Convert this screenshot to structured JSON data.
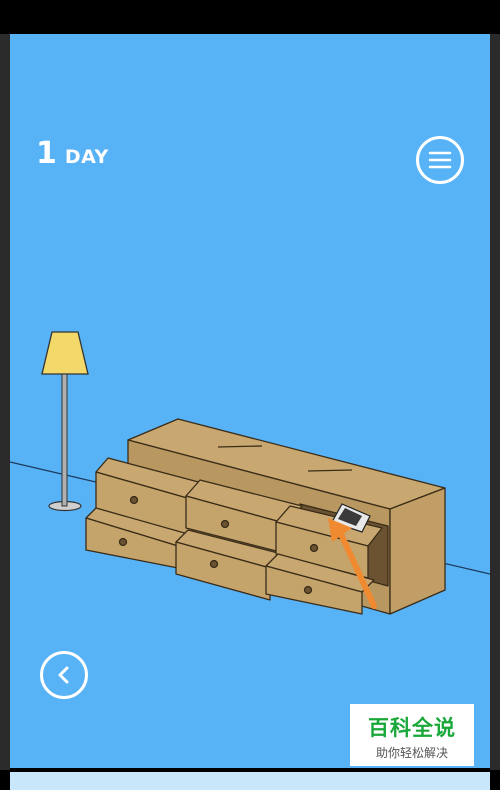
{
  "hud": {
    "day_number": "1",
    "day_label": "DAY"
  },
  "icons": {
    "menu": "hamburger-menu-icon",
    "back": "chevron-left-icon"
  },
  "scene": {
    "objects": [
      "floor-lamp",
      "wooden-dresser",
      "dresser-drawer",
      "tablet-in-drawer",
      "hint-arrow"
    ]
  },
  "watermark": {
    "title": "百科全说",
    "subtitle": "助你轻松解决"
  },
  "colors": {
    "background": "#58b2f6",
    "wood": "#c8a870",
    "lamp_shade": "#f3d86a",
    "arrow": "#f08a30"
  }
}
